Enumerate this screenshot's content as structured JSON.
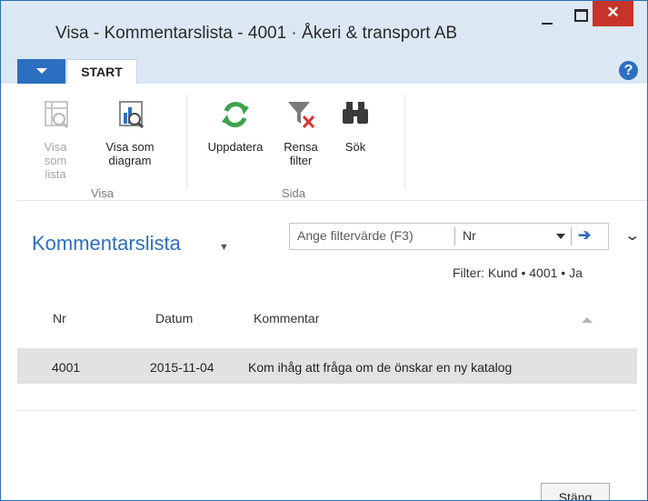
{
  "window": {
    "title": "Visa - Kommentarslista - 4001 · Åkeri & transport AB"
  },
  "ribbon": {
    "tab_start": "START",
    "help_label": "?",
    "groups": [
      {
        "label": "Visa"
      },
      {
        "label": "Sida"
      }
    ],
    "buttons": {
      "list_view": "Visa som lista",
      "chart_view": "Visa som diagram",
      "refresh": "Uppdatera",
      "clear_filter": "Rensa filter",
      "search": "Sök"
    }
  },
  "page": {
    "title": "Kommentarslista",
    "filter_placeholder": "Ange filtervärde (F3)",
    "filter_field": "Nr",
    "active_filter": "Filter: Kund • 4001 • Ja"
  },
  "table": {
    "columns": [
      "Nr",
      "Datum",
      "Kommentar"
    ],
    "rows": [
      {
        "nr": "4001",
        "datum": "2015-11-04",
        "kommentar": "Kom ihåg att fråga om de önskar en ny katalog"
      }
    ]
  },
  "footer": {
    "close_label": "Stäng"
  },
  "colors": {
    "accent": "#2c6fc0",
    "close_red": "#c7342a",
    "title_bg": "#dbe8f4",
    "selected_row": "#e2e2e2"
  }
}
